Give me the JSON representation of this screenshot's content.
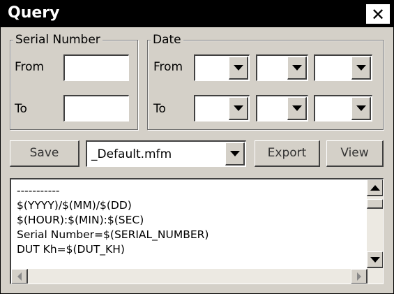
{
  "window": {
    "title": "Query",
    "close_glyph": "✕"
  },
  "serial_number": {
    "legend": "Serial Number",
    "from_label": "From",
    "to_label": "To",
    "from_value": "",
    "to_value": ""
  },
  "date": {
    "legend": "Date",
    "from_label": "From",
    "to_label": "To",
    "from_values": [
      "",
      "",
      ""
    ],
    "to_values": [
      "",
      "",
      ""
    ]
  },
  "toolbar": {
    "save_label": "Save",
    "format_selected": "_Default.mfm",
    "export_label": "Export",
    "view_label": "View"
  },
  "template_text": {
    "lines": [
      "-----------",
      "$(YYYY)/$(MM)/$(DD)",
      "$(HOUR):$(MIN):$(SEC)",
      "Serial Number=$(SERIAL_NUMBER)",
      "DUT Kh=$(DUT_KH)"
    ]
  },
  "icons": {
    "close": "close-icon",
    "dropdown": "chevron-down-icon",
    "scroll_up": "arrow-up-icon",
    "scroll_down": "arrow-down-icon",
    "scroll_left": "arrow-left-icon",
    "scroll_right": "arrow-right-icon"
  }
}
